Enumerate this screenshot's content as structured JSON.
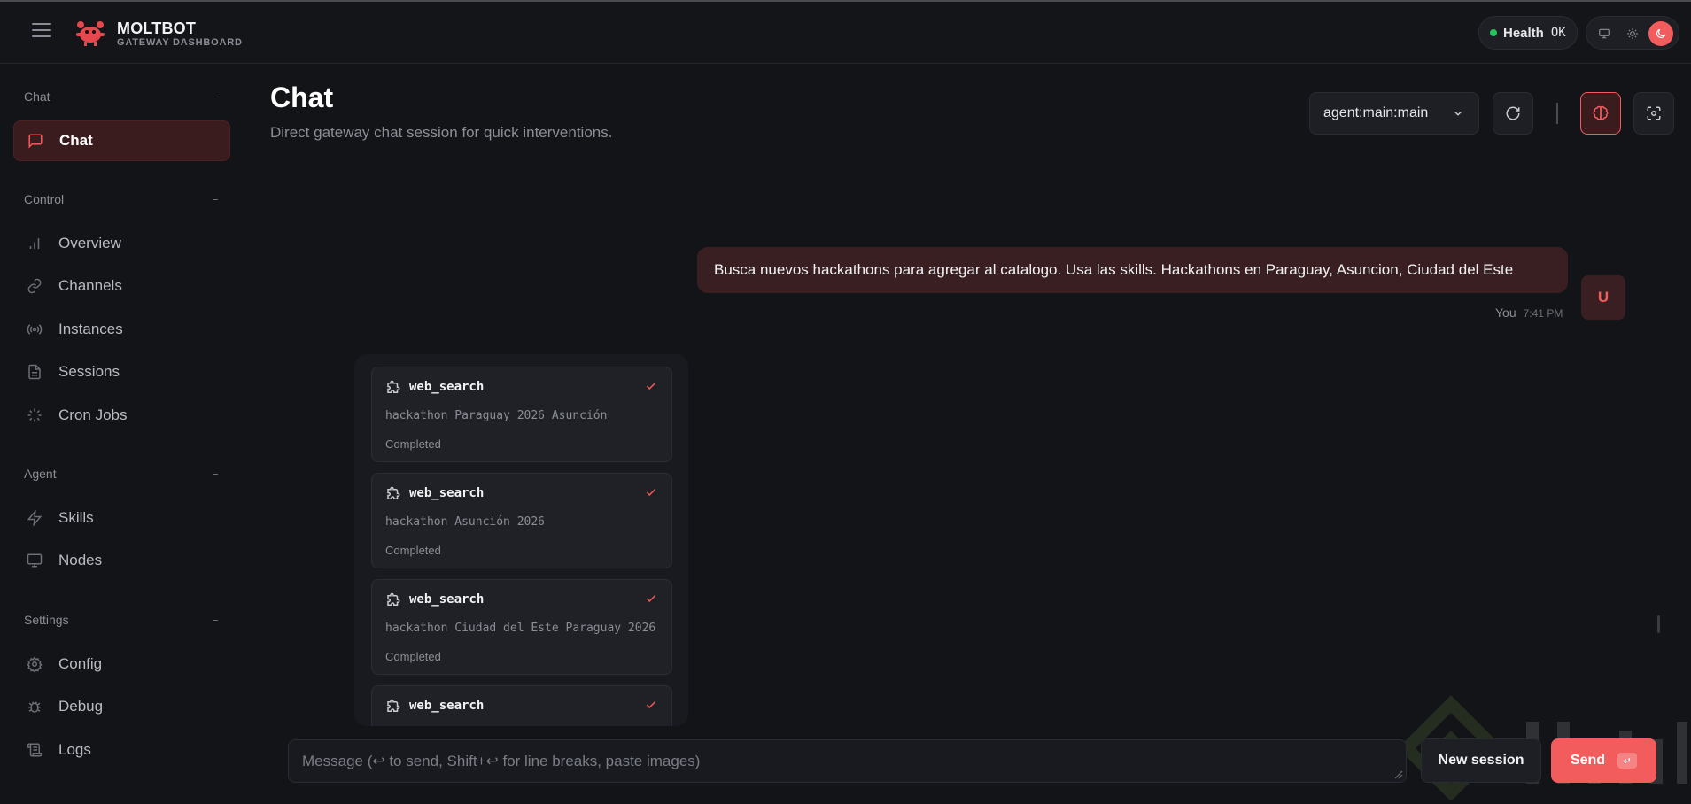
{
  "brand": {
    "name": "MOLTBOT",
    "subtitle": "GATEWAY DASHBOARD"
  },
  "health": {
    "label": "Health",
    "value": "OK",
    "status_color": "#22c55e"
  },
  "theme": {
    "options": [
      "monitor-icon",
      "sun-icon",
      "moon-icon"
    ],
    "active": "moon-icon"
  },
  "colors": {
    "accent": "#f25c5c",
    "background": "#131418",
    "active_nav_bg": "#3a1b1e",
    "user_bubble_bg": "#3a1f22"
  },
  "sidebar": {
    "sections": [
      {
        "title": "Chat",
        "items": [
          {
            "label": "Chat",
            "icon": "message-square-icon",
            "active": true
          }
        ]
      },
      {
        "title": "Control",
        "items": [
          {
            "label": "Overview",
            "icon": "bar-chart-icon"
          },
          {
            "label": "Channels",
            "icon": "link-icon"
          },
          {
            "label": "Instances",
            "icon": "radio-icon"
          },
          {
            "label": "Sessions",
            "icon": "file-text-icon"
          },
          {
            "label": "Cron Jobs",
            "icon": "loader-icon"
          }
        ]
      },
      {
        "title": "Agent",
        "items": [
          {
            "label": "Skills",
            "icon": "zap-icon"
          },
          {
            "label": "Nodes",
            "icon": "monitor-icon"
          }
        ]
      },
      {
        "title": "Settings",
        "items": [
          {
            "label": "Config",
            "icon": "settings-icon"
          },
          {
            "label": "Debug",
            "icon": "bug-icon"
          },
          {
            "label": "Logs",
            "icon": "scroll-icon"
          }
        ]
      }
    ]
  },
  "main": {
    "title": "Chat",
    "subtitle": "Direct gateway chat session for quick interventions.",
    "session_select": {
      "value": "agent:main:main"
    },
    "toolbar_icons": [
      "refresh-icon",
      "brain-icon",
      "focus-icon"
    ]
  },
  "messages": {
    "user": {
      "text": "Busca nuevos hackathons para agregar al catalogo. Usa las skills. Hackathons en Paraguay, Asuncion, Ciudad del Este",
      "author": "You",
      "time": "7:41 PM",
      "avatar": "U"
    },
    "tool_calls": [
      {
        "name": "web_search",
        "query": "hackathon Paraguay 2026 Asunción",
        "status": "Completed"
      },
      {
        "name": "web_search",
        "query": "hackathon Asunción 2026",
        "status": "Completed"
      },
      {
        "name": "web_search",
        "query": "hackathon Ciudad del Este Paraguay 2026",
        "status": "Completed"
      },
      {
        "name": "web_search",
        "query": "",
        "status": ""
      }
    ]
  },
  "composer": {
    "placeholder": "Message (↩ to send, Shift+↩ for line breaks, paste images)",
    "new_session_label": "New session",
    "send_label": "Send",
    "send_key": "↵"
  }
}
